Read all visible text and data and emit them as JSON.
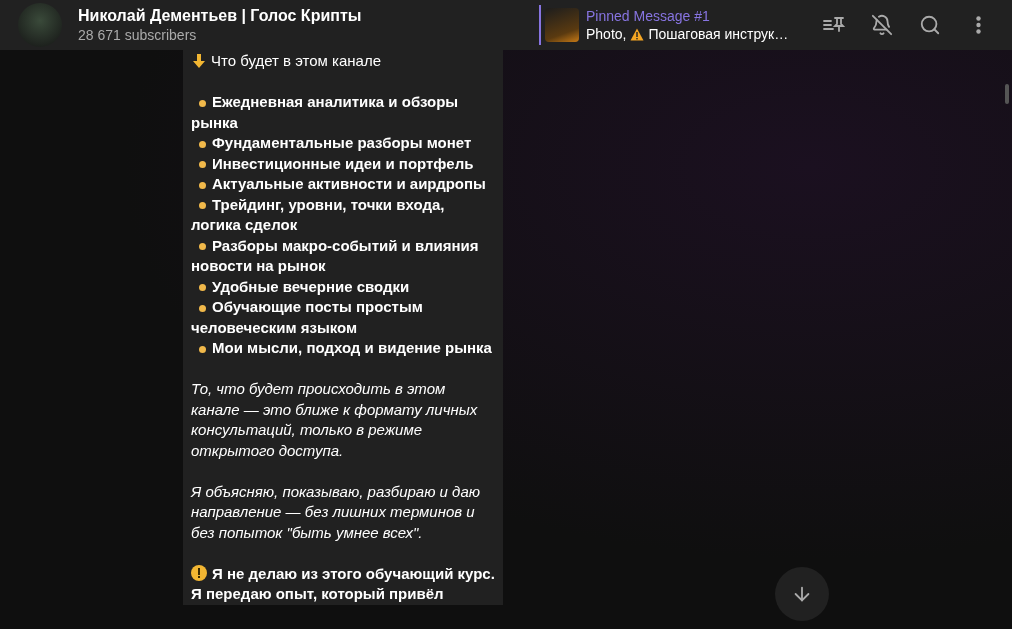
{
  "header": {
    "channel_name": "Николай Дементьев | Голос Крипты",
    "subscribers": "28 671 subscribers"
  },
  "pinned": {
    "title": "Pinned Message #1",
    "preview_prefix": "Photo,",
    "preview_text": "Пошаговая инструк…"
  },
  "message": {
    "sections": [
      {
        "kind": "heading",
        "lines": [
          "Что будет в этом канале"
        ]
      },
      {
        "kind": "bullets",
        "lines": [
          "Ежедневная аналитика и обзоры рынка",
          "Фундаментальные разборы монет",
          "Инвестиционные идеи и портфель",
          "Актуальные активности и аирдропы",
          "Трейдинг, уровни, точки входа, логика сделок",
          "Разборы макро-событий и влияния новости на рынок",
          "Удобные вечерние сводки",
          "Обучающие посты простым человеческим языком",
          "Мои мысли, подход и видение рынка"
        ]
      },
      {
        "kind": "italic",
        "lines": [
          "То, что будет происходить в этом канале — это ближе к формату личных консультаций, только в режиме открытого доступа."
        ]
      },
      {
        "kind": "italic",
        "lines": [
          "Я объясняю, показываю, разбираю и даю направление — без лишних терминов и без попыток \"быть умнее всех\"."
        ]
      },
      {
        "kind": "warning",
        "lines": [
          "Я не делаю из этого обучающий курс. Я передаю опыт, который привёл"
        ]
      }
    ]
  }
}
